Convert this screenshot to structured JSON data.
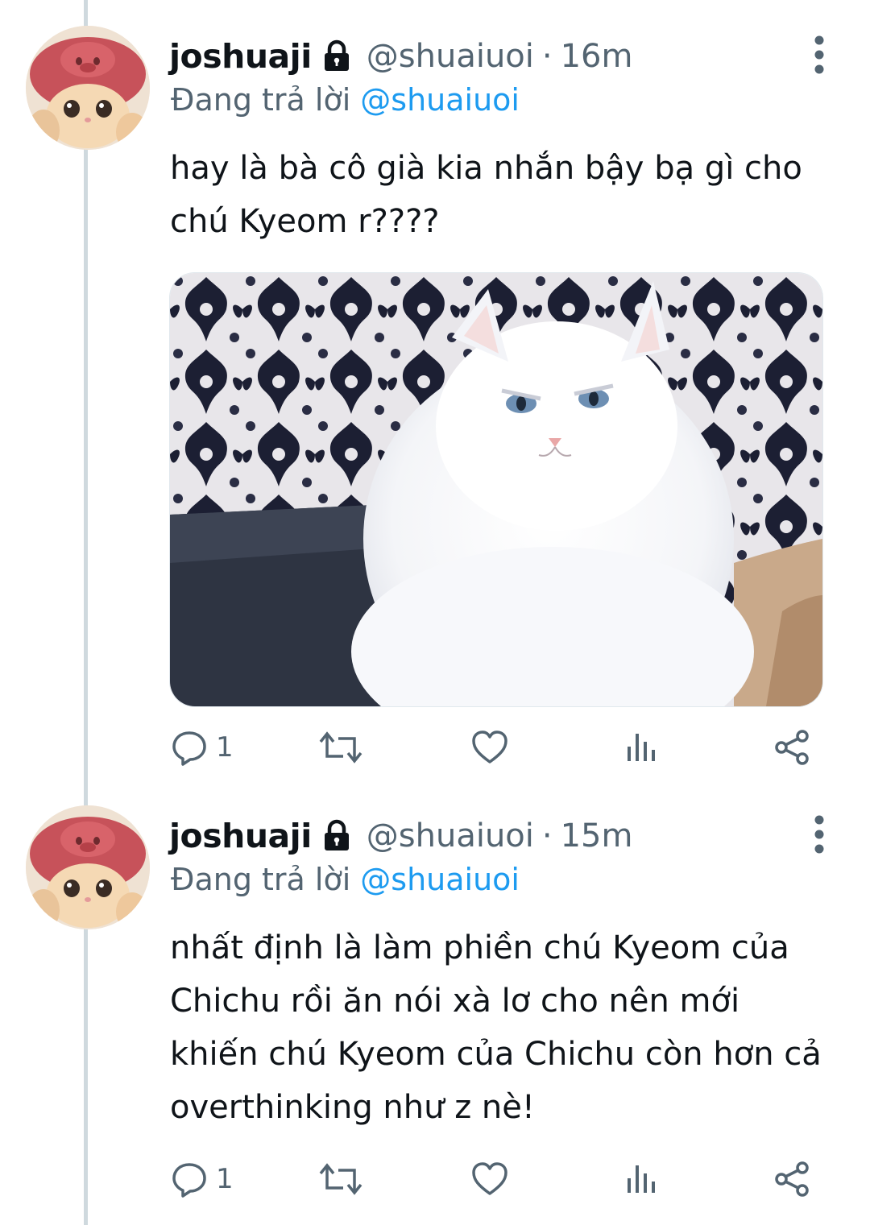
{
  "tweets": [
    {
      "display_name": "joshuaji",
      "handle": "@shuaiuoi",
      "separator": "·",
      "time": "16m",
      "reply_prefix": "Đang trả lời",
      "reply_to": "@shuaiuoi",
      "text_lines": [
        "hay là bà cô già kia nhắn bậy bạ gì cho",
        "chú Kyeom r????"
      ],
      "has_media": true,
      "actions": {
        "reply_count": "1"
      }
    },
    {
      "display_name": "joshuaji",
      "handle": "@shuaiuoi",
      "separator": "·",
      "time": "15m",
      "reply_prefix": "Đang trả lời",
      "reply_to": "@shuaiuoi",
      "text_lines": [
        "nhất định là làm phiền chú Kyeom của",
        "Chichu rồi ăn nói xà lơ cho nên mới",
        "khiến chú Kyeom của Chichu còn hơn cả",
        "overthinking như z nè!"
      ],
      "has_media": false,
      "actions": {
        "reply_count": "1"
      }
    }
  ],
  "icons": [
    "lock-icon",
    "more-icon",
    "reply-icon",
    "retweet-icon",
    "like-icon",
    "views-icon",
    "share-icon"
  ],
  "colors": {
    "link": "#1d9bf0",
    "secondary": "#536471",
    "text": "#0f1419",
    "thread_line": "#cfd9de"
  }
}
